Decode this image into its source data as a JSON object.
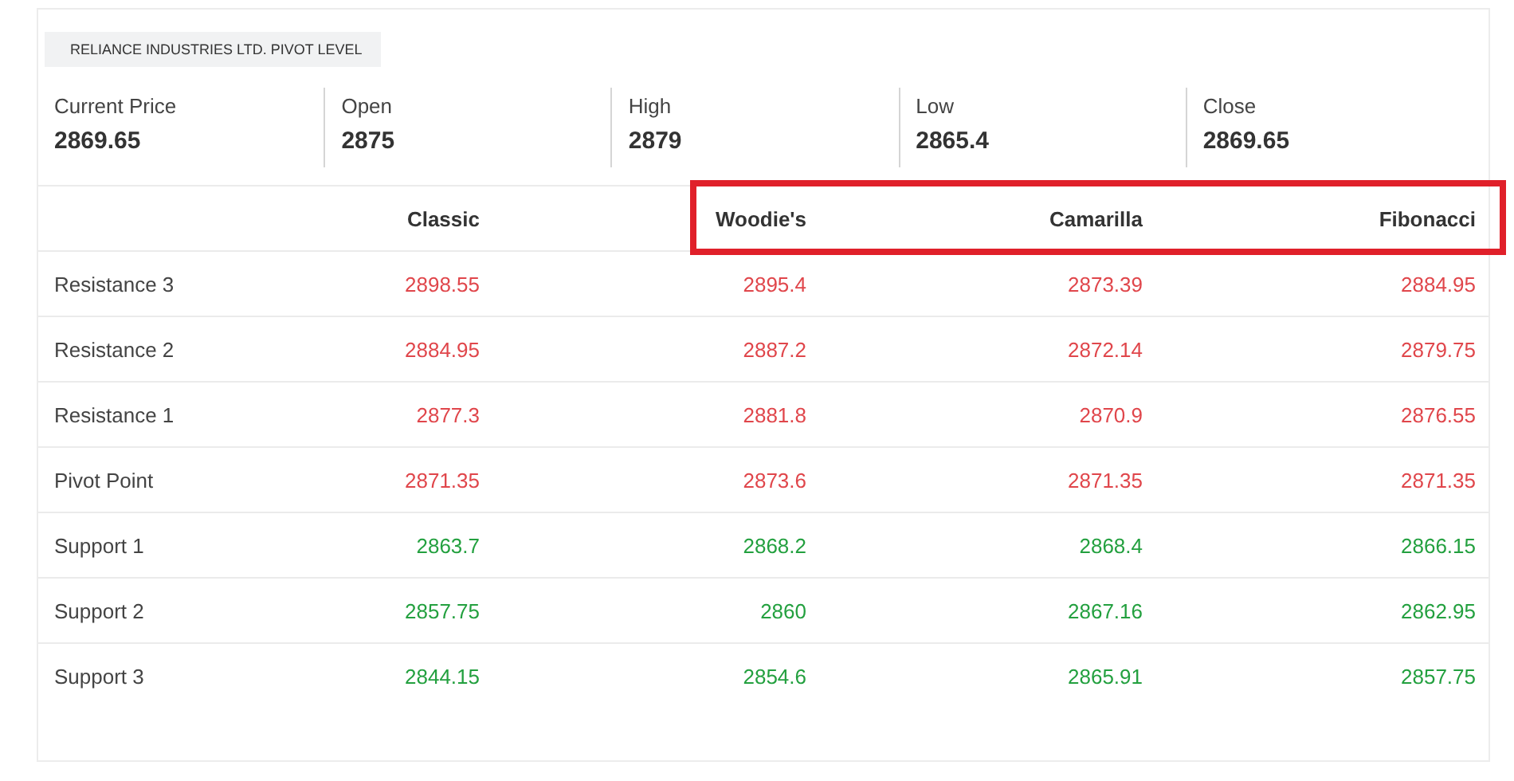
{
  "title": "RELIANCE INDUSTRIES LTD. PIVOT LEVEL",
  "stats": [
    {
      "label": "Current Price",
      "value": "2869.65"
    },
    {
      "label": "Open",
      "value": "2875"
    },
    {
      "label": "High",
      "value": "2879"
    },
    {
      "label": "Low",
      "value": "2865.4"
    },
    {
      "label": "Close",
      "value": "2869.65"
    }
  ],
  "table": {
    "columns": [
      "Classic",
      "Woodie's",
      "Camarilla",
      "Fibonacci"
    ],
    "highlight": {
      "kind": "frame",
      "color": "#e0202a"
    },
    "rows": [
      {
        "kind": "resistance",
        "label": "Resistance 3",
        "values": [
          "2898.55",
          "2895.4",
          "2873.39",
          "2884.95"
        ]
      },
      {
        "kind": "resistance",
        "label": "Resistance 2",
        "values": [
          "2884.95",
          "2887.2",
          "2872.14",
          "2879.75"
        ]
      },
      {
        "kind": "resistance",
        "label": "Resistance 1",
        "values": [
          "2877.3",
          "2881.8",
          "2870.9",
          "2876.55"
        ]
      },
      {
        "kind": "resistance",
        "label": "Pivot Point",
        "values": [
          "2871.35",
          "2873.6",
          "2871.35",
          "2871.35"
        ]
      },
      {
        "kind": "support",
        "label": "Support 1",
        "values": [
          "2863.7",
          "2868.2",
          "2868.4",
          "2866.15"
        ]
      },
      {
        "kind": "support",
        "label": "Support 2",
        "values": [
          "2857.75",
          "2860",
          "2867.16",
          "2862.95"
        ]
      },
      {
        "kind": "support",
        "label": "Support 3",
        "values": [
          "2844.15",
          "2854.6",
          "2865.91",
          "2857.75"
        ]
      }
    ]
  }
}
